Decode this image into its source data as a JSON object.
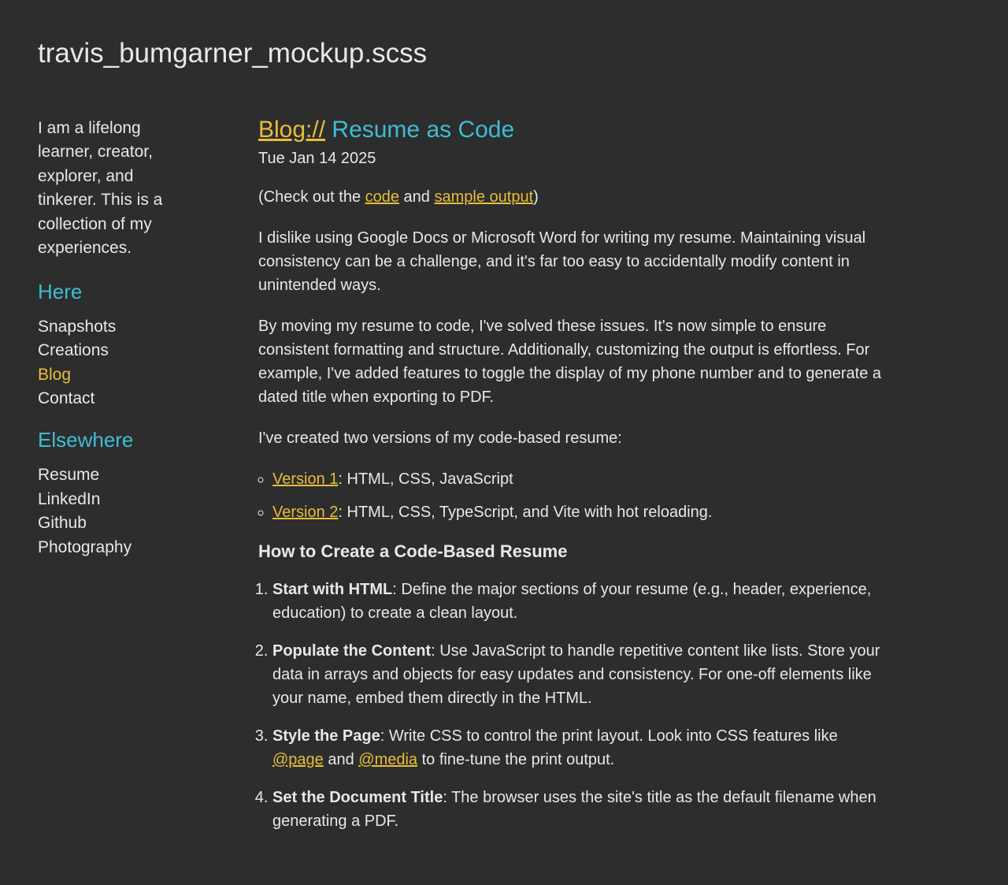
{
  "page_title": "travis_bumgarner_mockup.scss",
  "sidebar": {
    "intro": "I am a lifelong learner, creator, explorer, and tinkerer. This is a collection of my experiences.",
    "sections": [
      {
        "heading": "Here",
        "items": [
          "Snapshots",
          "Creations",
          "Blog",
          "Contact"
        ],
        "active_index": 2
      },
      {
        "heading": "Elsewhere",
        "items": [
          "Resume",
          "LinkedIn",
          "Github",
          "Photography"
        ],
        "active_index": -1
      }
    ]
  },
  "post": {
    "prefix": "Blog://",
    "title": " Resume as Code",
    "date": "Tue Jan 14 2025",
    "intro_pre": "(Check out the ",
    "link_code": "code",
    "intro_mid": " and ",
    "link_sample": "sample output",
    "intro_post": ")",
    "para1": "I dislike using Google Docs or Microsoft Word for writing my resume. Maintaining visual consistency can be a challenge, and it's far too easy to accidentally modify content in unintended ways.",
    "para2": "By moving my resume to code, I've solved these issues. It's now simple to ensure consistent formatting and structure. Additionally, customizing the output is effortless. For example, I've added features to toggle the display of my phone number and to generate a dated title when exporting to PDF.",
    "para3": "I've created two versions of my code-based resume:",
    "versions": [
      {
        "link": "Version 1",
        "desc": ": HTML, CSS, JavaScript"
      },
      {
        "link": "Version 2",
        "desc": ": HTML, CSS, TypeScript, and Vite with hot reloading."
      }
    ],
    "howto_heading": "How to Create a Code-Based Resume",
    "steps": [
      {
        "label": "Start with HTML",
        "desc": ": Define the major sections of your resume (e.g., header, experience, education) to create a clean layout."
      },
      {
        "label": "Populate the Content",
        "desc": ": Use JavaScript to handle repetitive content like lists. Store your data in arrays and objects for easy updates and consistency. For one-off elements like your name, embed them directly in the HTML."
      },
      {
        "label": "Style the Page",
        "desc_pre": ": Write CSS to control the print layout. Look into CSS features like ",
        "link1": "@page",
        "desc_mid": " and ",
        "link2": "@media",
        "desc_post": " to fine-tune the print output."
      },
      {
        "label": "Set the Document Title",
        "desc": ": The browser uses the site's title as the default filename when generating a PDF."
      }
    ]
  }
}
